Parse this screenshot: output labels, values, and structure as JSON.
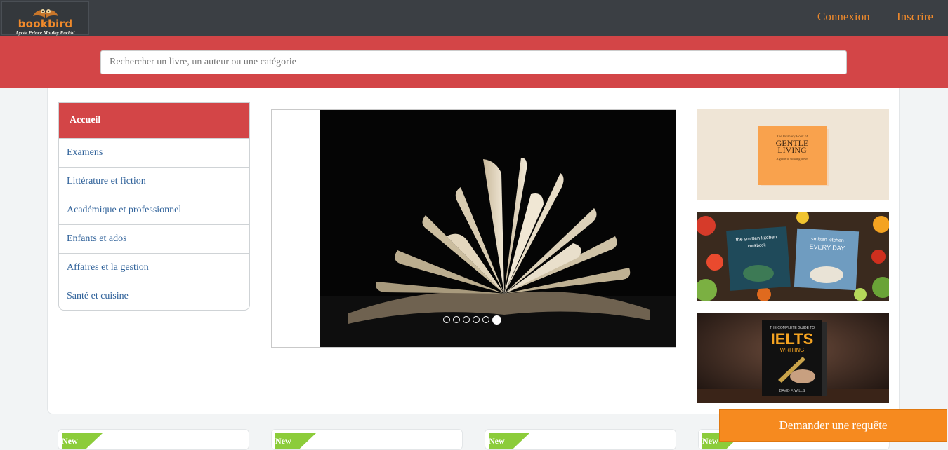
{
  "brand": {
    "name": "bookbird",
    "subtitle": "Lycée Prince Moulay Rachid",
    "icon": "owl-book-logo"
  },
  "nav": {
    "login": "Connexion",
    "register": "Inscrire"
  },
  "search": {
    "placeholder": "Rechercher un livre, un auteur ou une catégorie",
    "value": ""
  },
  "sidebar": {
    "title": "Accueil",
    "items": [
      {
        "label": "Examens"
      },
      {
        "label": "Littérature et fiction"
      },
      {
        "label": "Académique et professionnel"
      },
      {
        "label": "Enfants et ados"
      },
      {
        "label": "Affaires et la gestion"
      },
      {
        "label": "Santé et cuisine"
      }
    ]
  },
  "carousel": {
    "slide_count": 6,
    "active_slide": 6
  },
  "side_books": [
    {
      "title_line1": "GENTLE",
      "title_line2": "LIVING",
      "top": "The Intimacy Book of",
      "sub": "A guide to slowing down"
    },
    {
      "left_title": "the smitten kitchen",
      "left_sub": "cookbook",
      "right_title": "smitten kitchen",
      "right_sub": "EVERY DAY"
    },
    {
      "top": "THE COMPLETE GUIDE TO",
      "title": "IELTS",
      "sub": "WRITING",
      "author": "DAVID F. WILLS"
    }
  ],
  "cards": [
    {
      "badge": "New"
    },
    {
      "badge": "New"
    },
    {
      "badge": "New"
    },
    {
      "badge": "New"
    }
  ],
  "request_button": "Demander une requête",
  "colors": {
    "navbar": "#3b3f44",
    "brand_orange": "#f08a2b",
    "accent_red": "#d34547",
    "link_blue": "#30629a",
    "badge_green": "#8ccc3a",
    "request_orange": "#f68a1f"
  }
}
